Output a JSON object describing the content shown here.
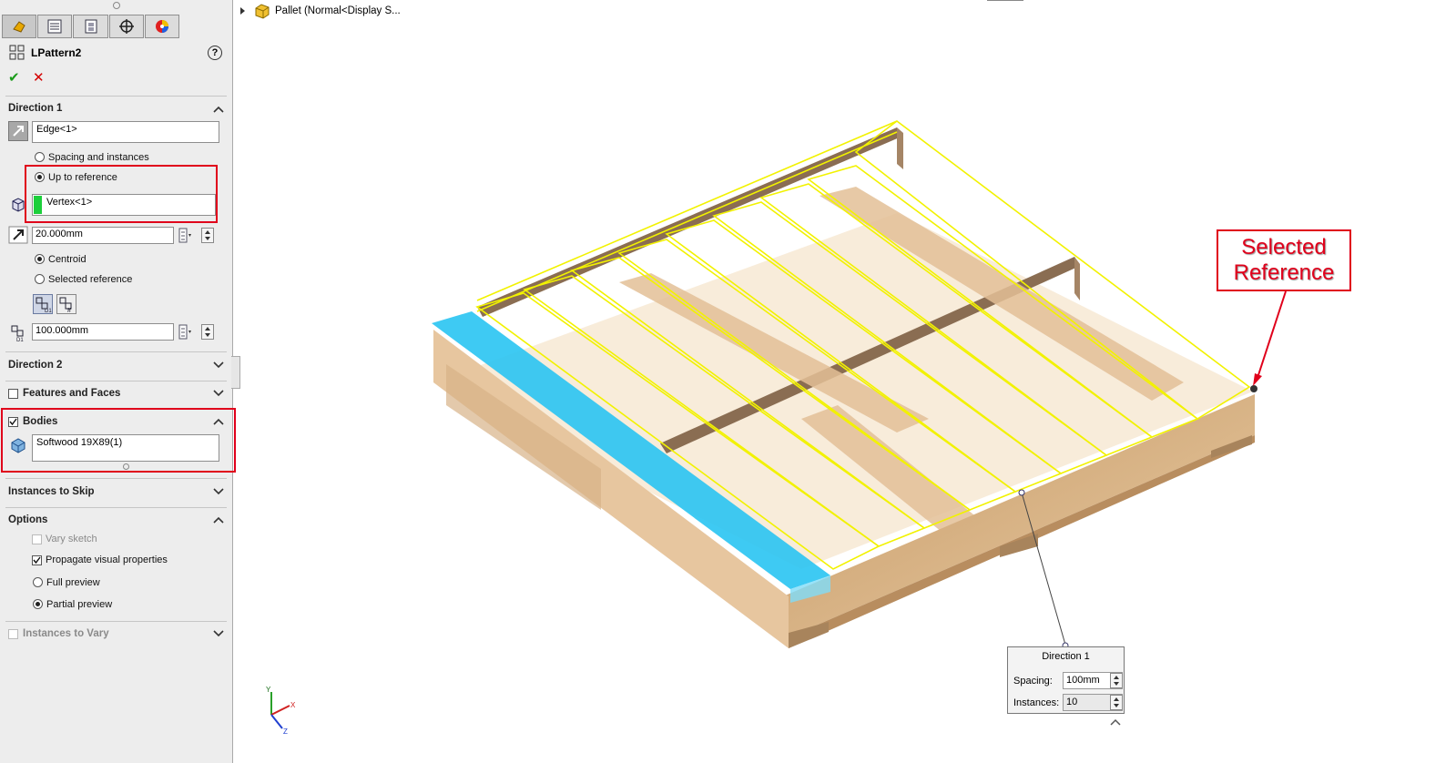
{
  "feature": {
    "title": "LPattern2"
  },
  "actions": {
    "ok": "✔",
    "cancel": "✕"
  },
  "direction1": {
    "header": "Direction 1",
    "edge_value": "Edge<1>",
    "spacing_option": "Spacing and instances",
    "upto_option": "Up to reference",
    "reference_value": "Vertex<1>",
    "offset_value": "20.000mm",
    "centroid_option": "Centroid",
    "selected_ref_option": "Selected reference",
    "spacing_value": "100.000mm"
  },
  "direction2": {
    "header": "Direction 2"
  },
  "features_faces": {
    "header": "Features and Faces"
  },
  "bodies": {
    "header": "Bodies",
    "value": "Softwood 19X89(1)"
  },
  "instances_to_skip": {
    "header": "Instances to Skip"
  },
  "options": {
    "header": "Options",
    "vary_sketch": "Vary sketch",
    "propagate": "Propagate visual properties",
    "full_preview": "Full preview",
    "partial_preview": "Partial preview"
  },
  "instances_to_vary": {
    "header": "Instances to Vary"
  },
  "tree": {
    "label": "Pallet  (Normal<Display S..."
  },
  "callout": {
    "line1": "Selected",
    "line2": "Reference"
  },
  "dir_popup": {
    "title": "Direction 1",
    "spacing_label": "Spacing:",
    "spacing_value": "100mm",
    "instances_label": "Instances:",
    "instances_value": "10"
  },
  "colors": {
    "accent_red": "#e0001b",
    "selection_blue": "#29c4f2",
    "preview_yellow": "#f2f200",
    "wood": "#d9b48a"
  }
}
